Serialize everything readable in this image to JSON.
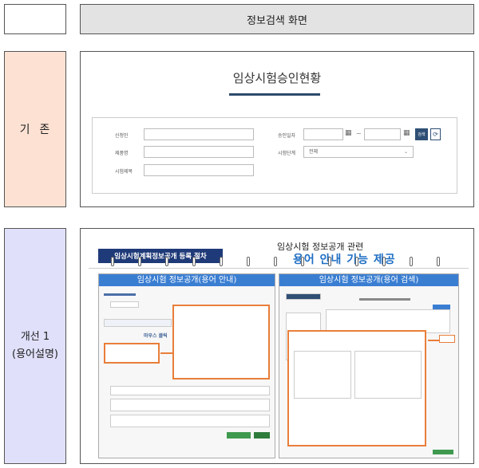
{
  "row1": {
    "label": "",
    "title": "정보검색 화면"
  },
  "row2": {
    "label": "기  존",
    "screen": {
      "title": "임상시험승인현황",
      "fields": {
        "applicant": "신청인",
        "product": "제품명",
        "trial_title": "시험제목",
        "approval_date": "승인일자",
        "phase": "시험단계",
        "phase_value": "전체",
        "tilde": "~",
        "search_button": "검색"
      }
    }
  },
  "row3": {
    "label_line1": "개선 1",
    "label_line2": "(용어설명)",
    "banner": {
      "procedure_label": "임상시험계획정보공개 등록 절차",
      "subtitle": "임상시험 정보공개 관련",
      "main_title": "용어 안내 기능 제공"
    },
    "left_panel": {
      "header": "임상시험 정보공개(용어 안내)",
      "mouse_label": "마우스 클릭"
    },
    "right_panel": {
      "header": "임상시험 정보공개(용어 검색)"
    }
  },
  "colors": {
    "accent_orange": "#e97e3a",
    "header_blue": "#3a7ed2",
    "navy": "#1f3a78",
    "title_blue": "#1e6ec4"
  }
}
